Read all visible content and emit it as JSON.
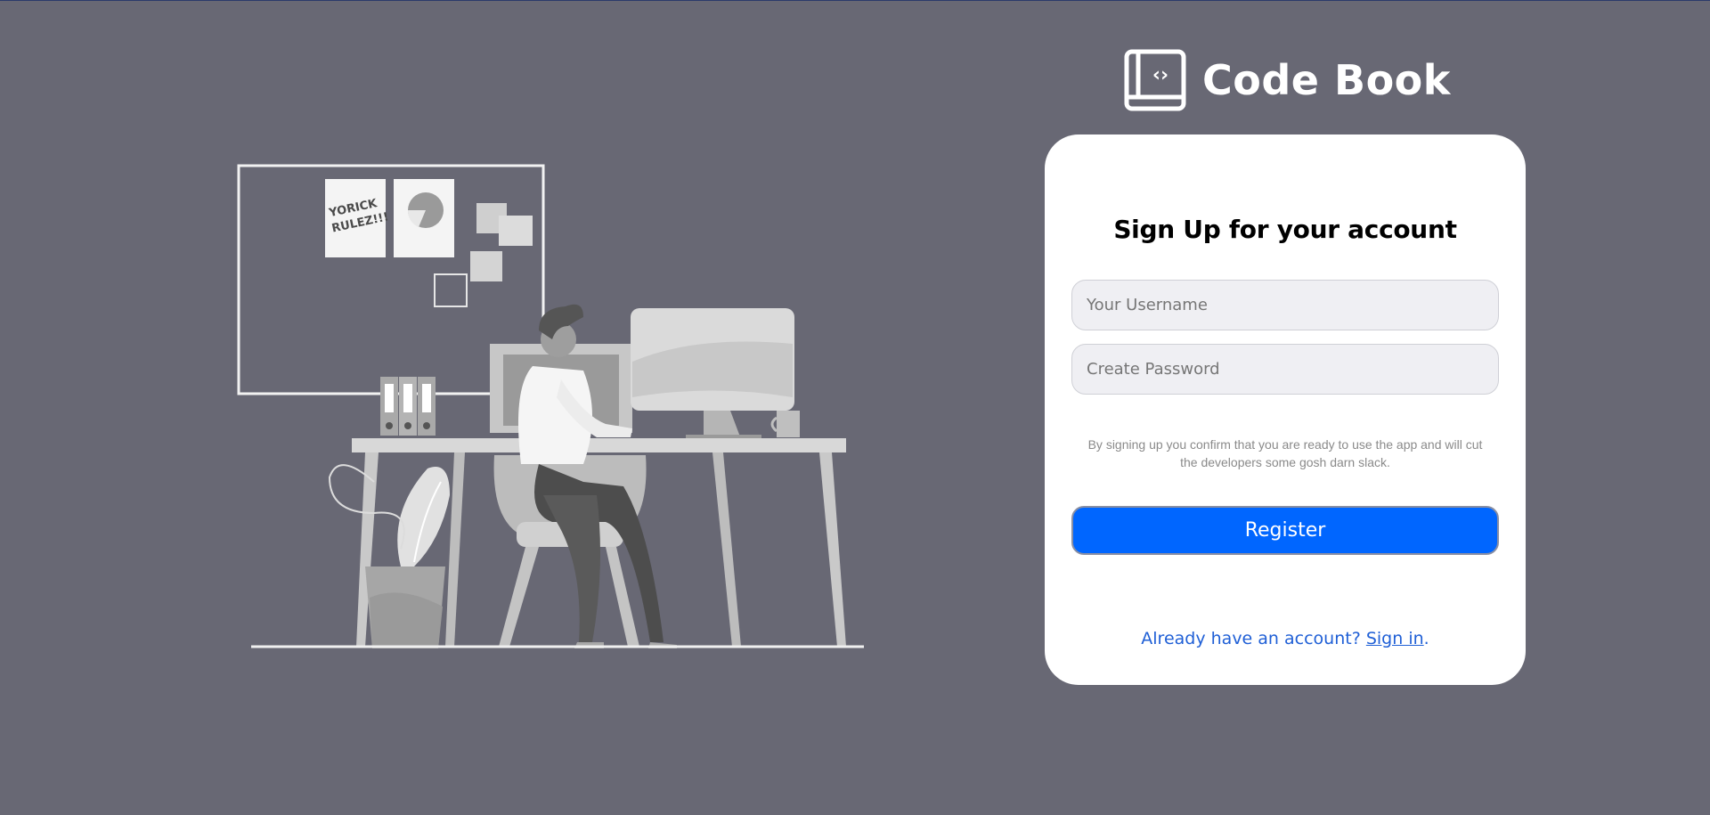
{
  "brand": {
    "name": "Code Book",
    "icon": "code-book-icon",
    "icon_glyph": "‹›"
  },
  "illustration": {
    "poster_text_line1": "YORICK",
    "poster_text_line2": "RULEZ!!!"
  },
  "signup": {
    "title": "Sign Up for your account",
    "username_placeholder": "Your Username",
    "password_placeholder": "Create Password",
    "notice": "By signing up you confirm that you are ready to use the app and will cut the developers some gosh darn slack.",
    "register_label": "Register",
    "signin_prompt": "Already have an account? ",
    "signin_link": "Sign in",
    "signin_suffix": "."
  },
  "colors": {
    "background": "#686874",
    "primary": "#0066ff",
    "link": "#1f5fd6",
    "card": "#ffffff"
  }
}
